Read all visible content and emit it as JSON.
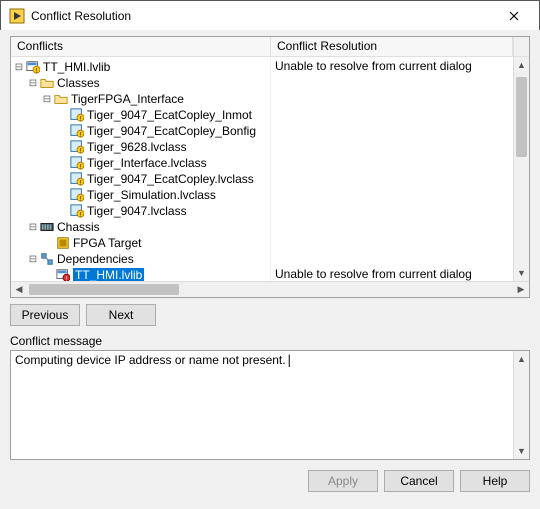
{
  "window": {
    "title": "Conflict Resolution"
  },
  "headers": {
    "conflicts": "Conflicts",
    "resolution": "Conflict Resolution"
  },
  "tree": {
    "root": "TT_HMI.lvlib",
    "root_resolution": "Unable to resolve from current dialog",
    "classes_label": "Classes",
    "classes_folder": "TigerFPGA_Interface",
    "class_items": [
      "Tiger_9047_EcatCopley_Inmot",
      "Tiger_9047_EcatCopley_Bonfig",
      "Tiger_9628.lvclass",
      "Tiger_Interface.lvclass",
      "Tiger_9047_EcatCopley.lvclass",
      "Tiger_Simulation.lvclass",
      "Tiger_9047.lvclass"
    ],
    "chassis_label": "Chassis",
    "fpga_label": "FPGA Target",
    "dep_label": "Dependencies",
    "dep_item": "TT_HMI.lvlib",
    "dep_resolution": "Unable to resolve from current dialog"
  },
  "nav": {
    "previous": "Previous",
    "next": "Next"
  },
  "message": {
    "label": "Conflict message",
    "text": "Computing device IP address or name not present."
  },
  "buttons": {
    "apply": "Apply",
    "cancel": "Cancel",
    "help": "Help"
  }
}
